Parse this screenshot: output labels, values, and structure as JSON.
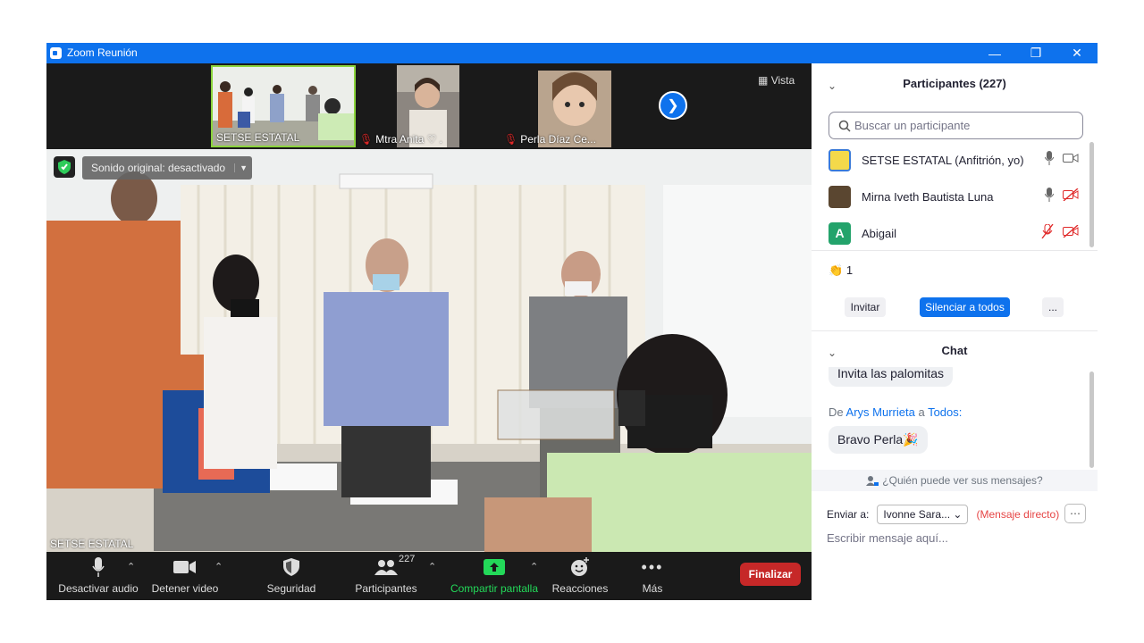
{
  "window": {
    "title": "Zoom Reunión"
  },
  "strip": {
    "thumbs": [
      {
        "name": "SETSE ESTATAL",
        "muted": false
      },
      {
        "name": "Mtra Anita ♡ .",
        "muted": true
      },
      {
        "name": "Perla Díaz Ce...",
        "muted": true
      }
    ],
    "view_label": "Vista"
  },
  "main": {
    "original_sound": "Sonido original: desactivado",
    "speaker_name": "SETSE ESTATAL"
  },
  "toolbar": {
    "mute": "Desactivar audio",
    "stop_video": "Detener video",
    "security": "Seguridad",
    "participants": "Participantes",
    "participants_count": "227",
    "share": "Compartir pantalla",
    "reactions": "Reacciones",
    "more": "Más",
    "end": "Finalizar"
  },
  "participants": {
    "title": "Participantes (227)",
    "search_placeholder": "Buscar un participante",
    "list": [
      {
        "name": "SETSE ESTATAL (Anfitrión, yo)",
        "mic": "on",
        "video": "on"
      },
      {
        "name": "Mirna Iveth Bautista Luna",
        "mic": "on",
        "video": "off"
      },
      {
        "name": "Abigail",
        "initial": "A",
        "mic": "off",
        "video": "off"
      }
    ],
    "raised_hands": "1",
    "invite": "Invitar",
    "mute_all": "Silenciar a todos",
    "more": "..."
  },
  "chat": {
    "title": "Chat",
    "messages": [
      {
        "text": "Invita las palomitas"
      },
      {
        "from_prefix": "De",
        "from": "Arys Murrieta",
        "to_prefix": "a",
        "to": "Todos:",
        "text": "Bravo Perla🎉"
      }
    ],
    "who_can_see": "¿Quién puede ver sus mensajes?",
    "send_to_label": "Enviar a:",
    "recipient": "Ivonne Sara...",
    "direct": "(Mensaje directo)",
    "placeholder": "Escribir mensaje aquí..."
  },
  "colors": {
    "zoom_blue": "#0e72ed",
    "end_red": "#c62828",
    "share_green": "#23d959"
  }
}
